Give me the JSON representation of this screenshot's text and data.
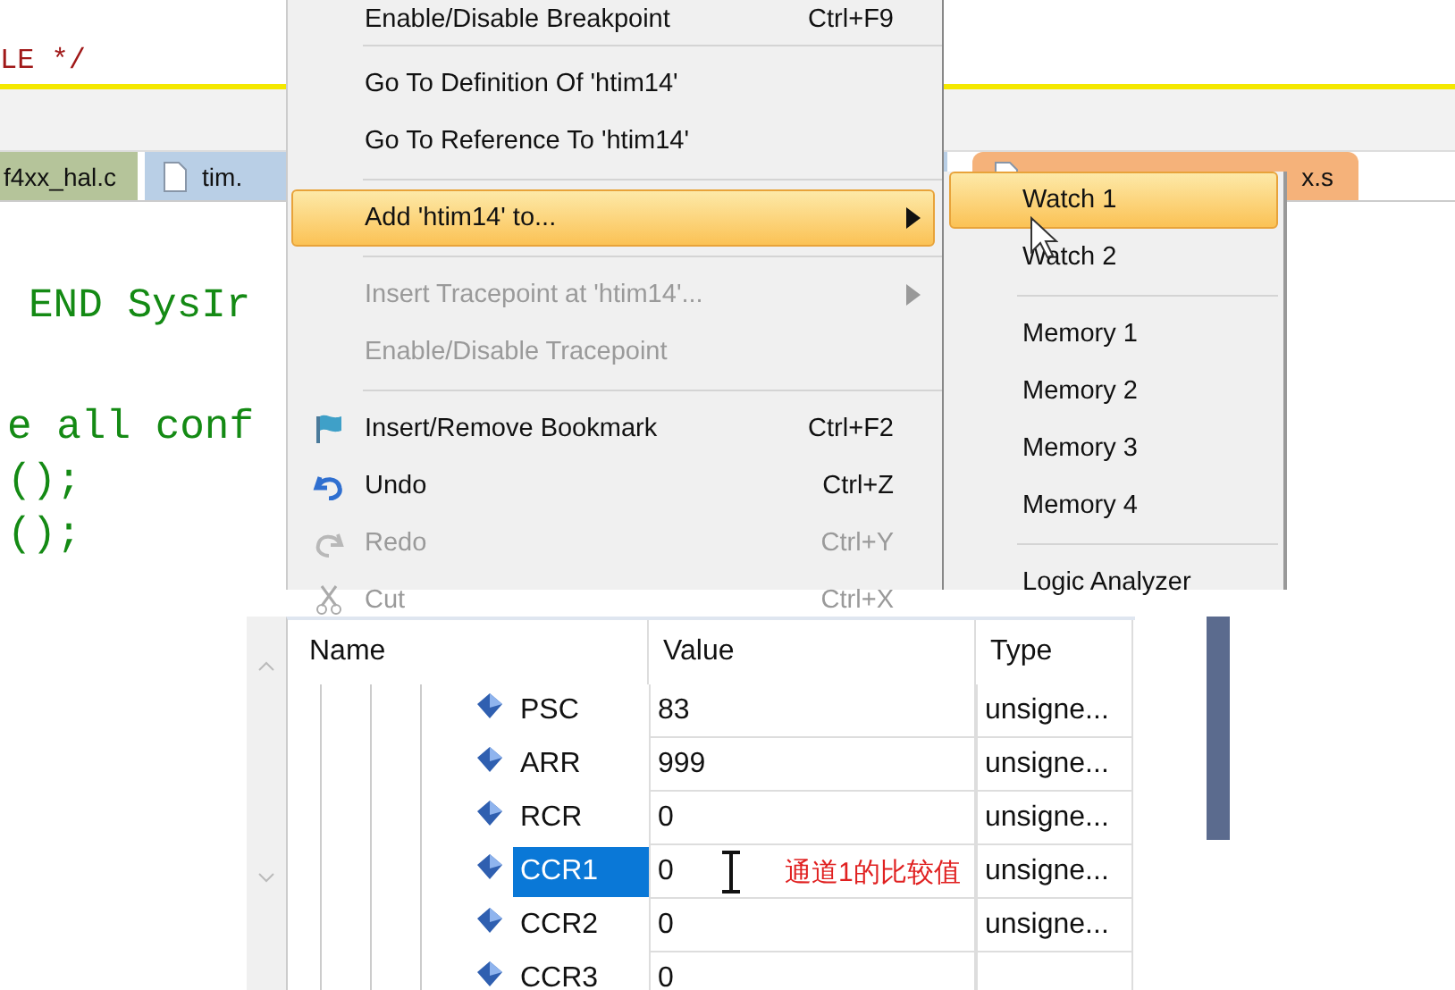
{
  "editor": {
    "comment_line": "LE */",
    "tabs": [
      {
        "label": "f4xx_hal.c",
        "color": "#b5c49a"
      },
      {
        "label": "tim.",
        "color": "#b9cfe6"
      },
      {
        "label": "x.s",
        "color": "#f5b27a"
      }
    ],
    "code_lines": [
      "END SysIr",
      "e all conf",
      "();",
      "();"
    ]
  },
  "context_menu": {
    "items": [
      {
        "kind": "item",
        "label": "Enable/Disable Breakpoint",
        "shortcut": "Ctrl+F9",
        "disabled": false,
        "highlighted": false,
        "submenu": false
      },
      {
        "kind": "separator"
      },
      {
        "kind": "item",
        "label": "Go To Definition Of 'htim14'",
        "disabled": false,
        "highlighted": false,
        "submenu": false
      },
      {
        "kind": "item",
        "label": "Go To Reference To 'htim14'",
        "disabled": false,
        "highlighted": false,
        "submenu": false
      },
      {
        "kind": "separator"
      },
      {
        "kind": "item",
        "label": "Add 'htim14' to...",
        "disabled": false,
        "highlighted": true,
        "submenu": true
      },
      {
        "kind": "separator"
      },
      {
        "kind": "item",
        "label": "Insert Tracepoint at 'htim14'...",
        "disabled": true,
        "highlighted": false,
        "submenu": true
      },
      {
        "kind": "item",
        "label": "Enable/Disable Tracepoint",
        "disabled": true,
        "highlighted": false,
        "submenu": false
      },
      {
        "kind": "separator"
      },
      {
        "kind": "bookmark",
        "label": "Insert/Remove Bookmark",
        "shortcut": "Ctrl+F2",
        "disabled": false,
        "highlighted": false,
        "submenu": false
      },
      {
        "kind": "undo",
        "label": "Undo",
        "shortcut": "Ctrl+Z",
        "disabled": false,
        "highlighted": false,
        "submenu": false
      },
      {
        "kind": "redo",
        "label": "Redo",
        "shortcut": "Ctrl+Y",
        "disabled": true,
        "highlighted": false,
        "submenu": false
      },
      {
        "kind": "cut",
        "label": "Cut",
        "shortcut": "Ctrl+X",
        "disabled": true,
        "highlighted": false,
        "submenu": false
      }
    ]
  },
  "submenu": {
    "items": [
      {
        "kind": "item",
        "label": "Watch 1",
        "highlighted": true
      },
      {
        "kind": "item",
        "label": "Watch 2",
        "highlighted": false
      },
      {
        "kind": "separator"
      },
      {
        "kind": "item",
        "label": "Memory 1",
        "highlighted": false
      },
      {
        "kind": "item",
        "label": "Memory 2",
        "highlighted": false
      },
      {
        "kind": "item",
        "label": "Memory 3",
        "highlighted": false
      },
      {
        "kind": "item",
        "label": "Memory 4",
        "highlighted": false
      },
      {
        "kind": "separator"
      },
      {
        "kind": "item",
        "label": "Logic Analyzer",
        "highlighted": false
      }
    ]
  },
  "watch": {
    "columns": [
      "Name",
      "Value",
      "Type"
    ],
    "rows": [
      {
        "name": "PSC",
        "value": "83",
        "type": "unsigne...",
        "selected": false
      },
      {
        "name": "ARR",
        "value": "999",
        "type": "unsigne...",
        "selected": false
      },
      {
        "name": "RCR",
        "value": "0",
        "type": "unsigne...",
        "selected": false
      },
      {
        "name": "CCR1",
        "value": "0",
        "type": "unsigne...",
        "selected": true
      },
      {
        "name": "CCR2",
        "value": "0",
        "type": "unsigne...",
        "selected": false
      },
      {
        "name": "CCR3",
        "value": "0",
        "selected": false
      }
    ],
    "annotation": "通道1的比较值"
  }
}
